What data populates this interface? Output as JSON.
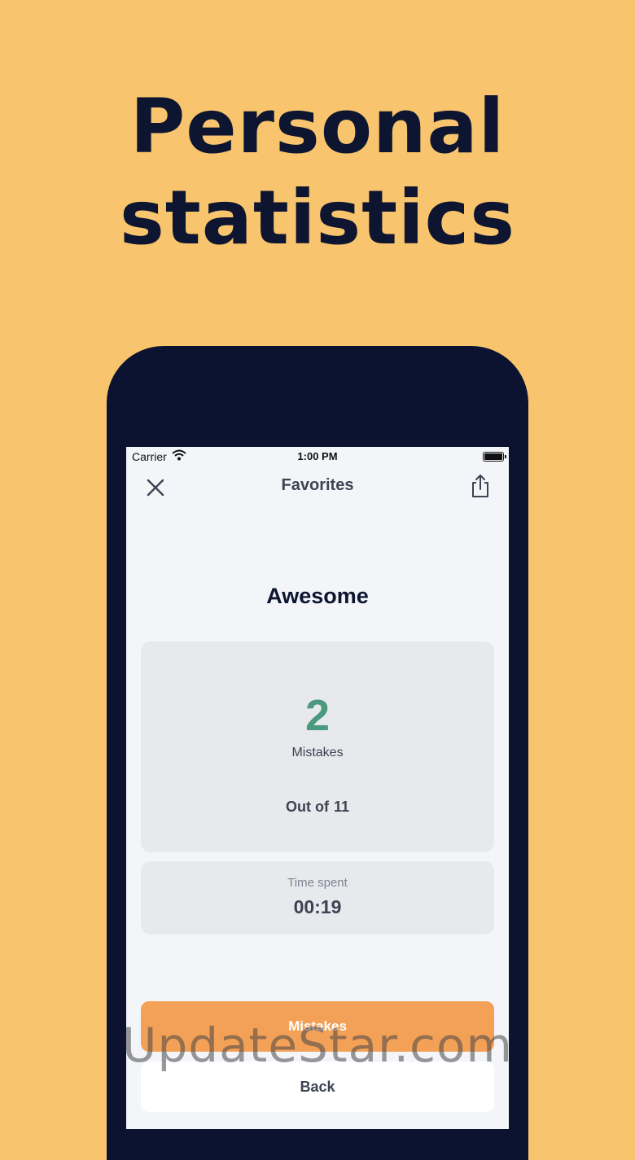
{
  "headline": {
    "line1": "Personal",
    "line2": "statistics"
  },
  "status_bar": {
    "carrier": "Carrier",
    "time": "1:00 PM"
  },
  "nav": {
    "title": "Favorites",
    "close_icon": "close-icon",
    "share_icon": "share-icon"
  },
  "result": {
    "title": "Awesome",
    "mistakes_count": "2",
    "mistakes_label": "Mistakes",
    "out_of_label": "Out of",
    "out_of_value": "11",
    "time_label": "Time spent",
    "time_value": "00:19"
  },
  "buttons": {
    "mistakes": "Mistakes",
    "back": "Back"
  },
  "watermark": "UpdateStar.com",
  "colors": {
    "background": "#F8C46D",
    "phone_frame": "#0B1330",
    "accent_green": "#4A9A7E",
    "mistakes_button": "#F4A158"
  }
}
